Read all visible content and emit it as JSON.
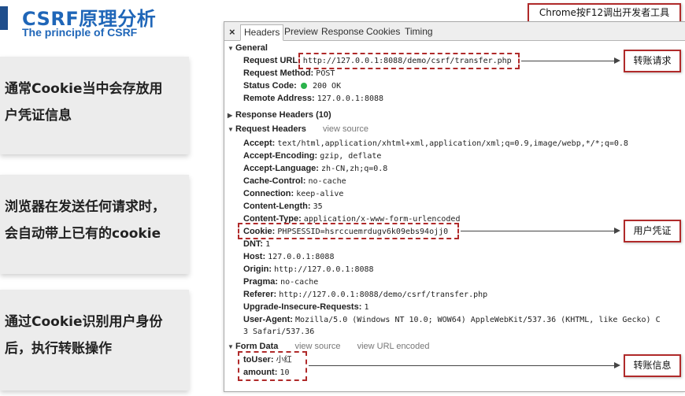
{
  "title": {
    "main": "CSRF原理分析",
    "sub": "The principle of CSRF"
  },
  "cards": [
    {
      "line1": "通常Cookie当中会存放用",
      "line2": "户凭证信息"
    },
    {
      "line1": "浏览器在发送任何请求时，",
      "line2": "会自动带上已有的cookie"
    },
    {
      "line1": "通过Cookie识别用户身份",
      "line2": "后，执行转账操作"
    }
  ],
  "devtools": {
    "close": "×",
    "tabs": [
      "Headers",
      "Preview",
      "Response",
      "Cookies",
      "Timing"
    ],
    "general": {
      "label": "General",
      "request_url_key": "Request URL:",
      "request_url": "http://127.0.0.1:8088/demo/csrf/transfer.php",
      "request_method_key": "Request Method:",
      "request_method": "POST",
      "status_code_key": "Status Code:",
      "status_code": "200 OK",
      "remote_address_key": "Remote Address:",
      "remote_address": "127.0.0.1:8088"
    },
    "response_headers": {
      "label": "Response Headers (10)"
    },
    "request_headers": {
      "label": "Request Headers",
      "view_source": "view source",
      "items": [
        {
          "k": "Accept:",
          "v": "text/html,application/xhtml+xml,application/xml;q=0.9,image/webp,*/*;q=0.8"
        },
        {
          "k": "Accept-Encoding:",
          "v": "gzip, deflate"
        },
        {
          "k": "Accept-Language:",
          "v": "zh-CN,zh;q=0.8"
        },
        {
          "k": "Cache-Control:",
          "v": "no-cache"
        },
        {
          "k": "Connection:",
          "v": "keep-alive"
        },
        {
          "k": "Content-Length:",
          "v": "35"
        },
        {
          "k": "Content-Type:",
          "v": "application/x-www-form-urlencoded"
        },
        {
          "k": "Cookie:",
          "v": "PHPSESSID=hsrccuemrdugv6k09ebs94ojj0"
        },
        {
          "k": "DNT:",
          "v": "1"
        },
        {
          "k": "Host:",
          "v": "127.0.0.1:8088"
        },
        {
          "k": "Origin:",
          "v": "http://127.0.0.1:8088"
        },
        {
          "k": "Pragma:",
          "v": "no-cache"
        },
        {
          "k": "Referer:",
          "v": "http://127.0.0.1:8088/demo/csrf/transfer.php"
        },
        {
          "k": "Upgrade-Insecure-Requests:",
          "v": "1"
        },
        {
          "k": "User-Agent:",
          "v": "Mozilla/5.0 (Windows NT 10.0; WOW64) AppleWebKit/537.36 (KHTML, like Gecko) C"
        }
      ],
      "ua_cont": "3 Safari/537.36"
    },
    "form_data": {
      "label": "Form Data",
      "view_source": "view source",
      "view_url_encoded": "view URL encoded",
      "to_user_key": "toUser:",
      "to_user": "小红",
      "amount_key": "amount:",
      "amount": "10"
    }
  },
  "callouts": {
    "chrome": "Chrome按F12调出开发者工具",
    "transfer_request": "转账请求",
    "user_credential": "用户凭证",
    "transfer_info": "转账信息"
  },
  "colors": {
    "title": "#1f66b8",
    "highlight": "#b02a2a",
    "status_ok": "#2bb34b"
  }
}
